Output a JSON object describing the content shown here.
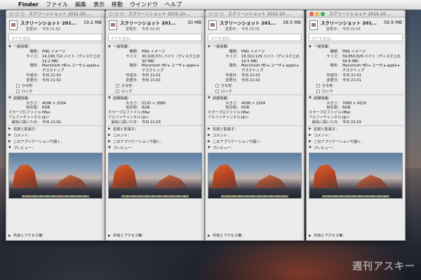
{
  "menubar": {
    "app": "Finder",
    "items": [
      "ファイル",
      "編集",
      "表示",
      "移動",
      "ウインドウ",
      "ヘルプ"
    ]
  },
  "labels": {
    "modified": "変更日：",
    "tag_placeholder": "タグを追加...",
    "general": "一般情報：",
    "kind": "種類：",
    "size": "サイズ：",
    "where": "場所：",
    "created": "作成日：",
    "modified2": "変更日：",
    "stationery": "ひな形",
    "locked": "ロック",
    "more_info": "詳細情報：",
    "dimensions": "大きさ：",
    "color_space": "色空間：",
    "color_profile": "カラープロファイル：",
    "alpha": "アルファチャンネル：",
    "last_opened": "最後に開いた日：",
    "name_ext": "名前と拡張子：",
    "comments": "コメント：",
    "open_with": "このアプリケーションで開く：",
    "preview": "プレビュー：",
    "sharing": "共有とアクセス権："
  },
  "windows": [
    {
      "title": "スクリーンショット 2015-10-...",
      "file_name": "スクリーンショット 201...",
      "file_size": "19.2 MB",
      "modified_short": "今日 21:02",
      "kind": "PNG イメージ",
      "size_detail": "19,190,722 バイト（ディスク上の 19.2 MB）",
      "where": "Macintosh HD ▸ ユーザ ▸ apple ▸ デスクトップ",
      "created": "今日 21:02",
      "modified": "今日 21:02",
      "dimensions": "4096 × 2304",
      "color_space": "RGB",
      "color_profile": "iMac",
      "alpha": "はい",
      "last_opened": "今日 21:02",
      "active": false
    },
    {
      "title": "スクリーンショット 2015-10-...",
      "file_name": "スクリーンショット 201...",
      "file_size": "30 MB",
      "modified_short": "今日 21:01",
      "kind": "PNG イメージ",
      "size_detail": "30,026,571 バイト（ディスク上の 30 MB）",
      "where": "Macintosh HD ▸ ユーザ ▸ apple ▸ デスクトップ",
      "created": "今日 21:01",
      "modified": "今日 21:01",
      "dimensions": "5120 × 2880",
      "color_space": "RGB",
      "color_profile": "iMac",
      "alpha": "はい",
      "last_opened": "今日 21:03",
      "active": false
    },
    {
      "title": "スクリーンショット 2015-10-...",
      "file_name": "スクリーンショット 201...",
      "file_size": "18.5 MB",
      "modified_short": "今日 21:01",
      "kind": "PNG イメージ",
      "size_detail": "18,522,129 バイト（ディスク上の 18.5 MB）",
      "where": "Macintosh HD ▸ ユーザ ▸ apple ▸ デスクトップ",
      "created": "今日 21:01",
      "modified": "今日 21:01",
      "dimensions": "4096 × 2304",
      "color_space": "RGB",
      "color_profile": "iMac",
      "alpha": "はい",
      "last_opened": "",
      "active": false
    },
    {
      "title": "スクリーンショット 2015-10-...",
      "file_name": "スクリーンショット 201...",
      "file_size": "59.9 MB",
      "modified_short": "今日 21:01",
      "kind": "PNG イメージ",
      "size_detail": "59,850,829 バイト（ディスク上の 59.9 MB）",
      "where": "Macintosh HD ▸ ユーザ ▸ apple ▸ デスクトップ",
      "created": "今日 21:01",
      "modified": "今日 21:01",
      "dimensions": "7680 × 4320",
      "color_space": "RGB",
      "color_profile": "iMac",
      "alpha": "はい",
      "last_opened": "今日 21:03",
      "active": true
    }
  ],
  "watermark": "週刊アスキー"
}
